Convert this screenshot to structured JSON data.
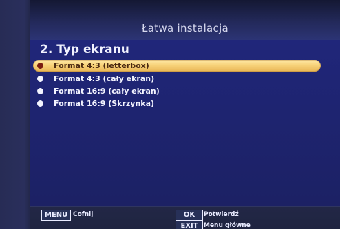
{
  "menu": {
    "title": "Łatwa instalacja",
    "section_heading": "2. Typ ekranu",
    "options": [
      {
        "label": "Format 4:3 (letterbox)",
        "selected": true
      },
      {
        "label": "Format 4:3 (cały ekran)",
        "selected": false
      },
      {
        "label": "Format 16:9 (cały ekran)",
        "selected": false
      },
      {
        "label": "Format 16:9 (Skrzynka)",
        "selected": false
      }
    ]
  },
  "footer": {
    "menu_key": "MENU",
    "menu_action": "Cofnij",
    "ok_key": "OK",
    "ok_action": "Potwierdź",
    "exit_key": "EXIT",
    "exit_action": "Menu główne"
  },
  "colors": {
    "panel_blue": "#1e2470",
    "highlight_gold": "#f7d27a"
  }
}
